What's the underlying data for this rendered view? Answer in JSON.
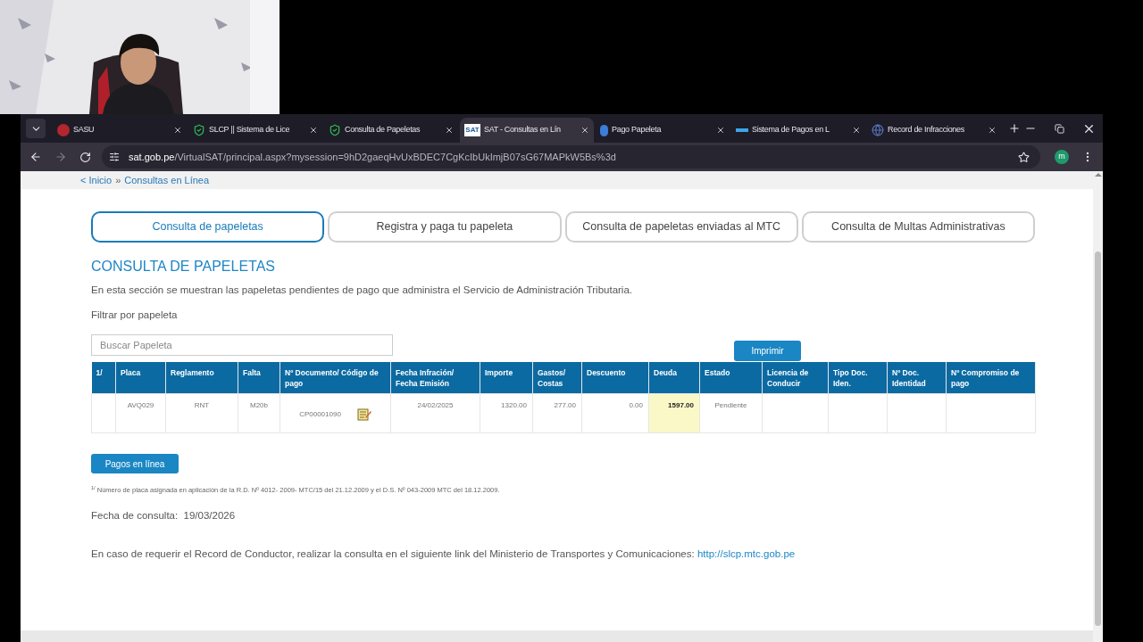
{
  "browser": {
    "tabs": [
      {
        "title": "SASU",
        "selected": false
      },
      {
        "title": "SLCP || Sistema de Lice",
        "selected": false
      },
      {
        "title": "Consulta de Papeletas",
        "selected": false
      },
      {
        "title": "SAT - Consultas en Lín",
        "selected": true,
        "badge": "SAT"
      },
      {
        "title": "Pago Papeleta",
        "selected": false
      },
      {
        "title": "Sistema de Pagos en L",
        "selected": false
      },
      {
        "title": "Record de Infracciones",
        "selected": false
      }
    ],
    "url_host": "sat.gob.pe",
    "url_path": "/VirtualSAT/principal.aspx?mysession=9hD2gaeqHvUxBDEC7CgKcIbUkImjB07sG67MAPkW5Bs%3d",
    "profile": "m"
  },
  "breadcrumb": {
    "home": "< Inicio",
    "separator": "»",
    "current": "Consultas en Línea"
  },
  "page_tabs": [
    {
      "label": "Consulta de papeletas",
      "selected": true
    },
    {
      "label": "Registra y paga tu papeleta",
      "selected": false
    },
    {
      "label": "Consulta de papeletas enviadas al MTC",
      "selected": false
    },
    {
      "label": "Consulta de Multas Administrativas",
      "selected": false
    }
  ],
  "title": "CONSULTA DE PAPELETAS",
  "description": "En esta sección se muestran las papeletas pendientes de pago que administra el Servicio de Administración Tributaria.",
  "filter_label": "Filtrar por papeleta",
  "search": {
    "placeholder": "Buscar Papeleta"
  },
  "print_button": "Imprimir",
  "table": {
    "columns": [
      "1/",
      "Placa",
      "Reglamento",
      "Falta",
      "Nº Documento/ Código de pago",
      "Fecha Infración/ Fecha Emisión",
      "Importe",
      "Gastos/ Costas",
      "Descuento",
      "Deuda",
      "Estado",
      "Licencia de Conducir",
      "Tipo Doc. Iden.",
      "Nº Doc. Identidad",
      "Nº Compromiso de pago"
    ],
    "rows": [
      {
        "cells": [
          {
            "highlighted": false
          },
          {
            "text": "AVQ029",
            "highlighted": false
          },
          {
            "text": "RNT",
            "highlighted": false
          },
          {
            "text": "M20b",
            "highlighted": false
          },
          {
            "text": "CP00001090",
            "highlighted": false,
            "icon": true
          },
          {
            "text": "24/02/2025",
            "highlighted": false
          },
          {
            "text": "1320.00",
            "highlighted": false
          },
          {
            "text": "277.00",
            "highlighted": false
          },
          {
            "text": "0.00",
            "highlighted": false
          },
          {
            "text": "1597.00",
            "highlighted": true
          },
          {
            "text": "Pendiente",
            "highlighted": false
          },
          {
            "highlighted": false
          },
          {
            "highlighted": false
          },
          {
            "highlighted": false
          },
          {
            "highlighted": false
          }
        ]
      }
    ]
  },
  "pay_button": "Pagos en línea",
  "footnote": "$^{1/}$ Número de placa asignada en aplicación de la R.D. Nº 4012- 2009- MTC/15 del 21.12.2009 y el D.S. Nº 043-2009 MTC del 18.12.2009.",
  "query_date": {
    "label": "Fecha de consulta:",
    "value": "19/03/2026"
  },
  "record_note": {
    "text": "En caso de requerir el Record de Conductor, realizar la consulta en el siguiente link del Ministerio de Transportes y Comunicaciones:",
    "link": "http://slcp.mtc.gob.pe"
  }
}
